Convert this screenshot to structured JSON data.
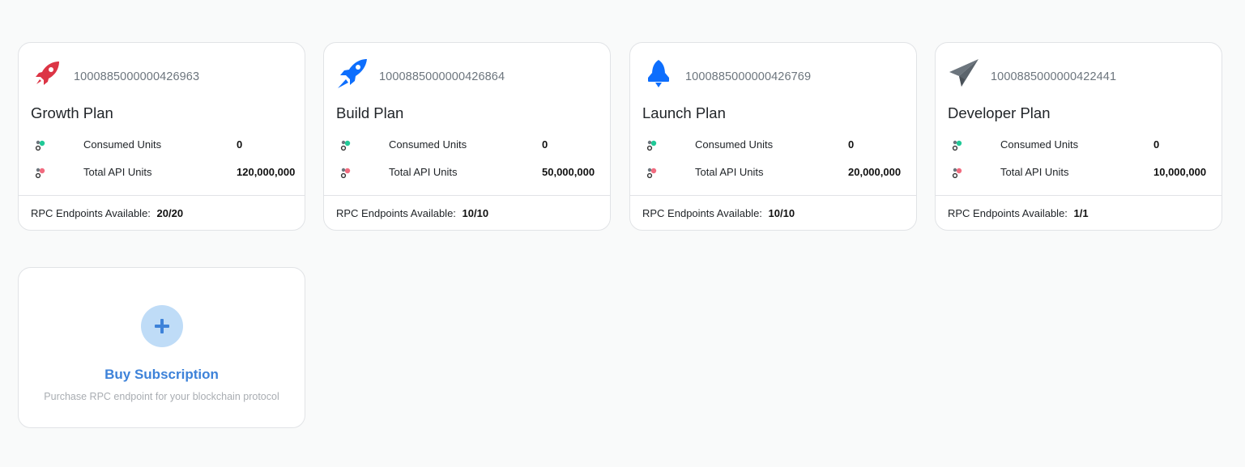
{
  "plans": [
    {
      "id": "1000885000000426963",
      "name": "Growth Plan",
      "icon": "rocket-icon",
      "icon_color": "#dc3545",
      "consumed_label": "Consumed Units",
      "consumed_value": "0",
      "total_label": "Total API Units",
      "total_value": "120,000,000",
      "footer_label": "RPC Endpoints Available:",
      "footer_value": "20/20"
    },
    {
      "id": "1000885000000426864",
      "name": "Build Plan",
      "icon": "rocket-takeoff-icon",
      "icon_color": "#0d6efd",
      "consumed_label": "Consumed Units",
      "consumed_value": "0",
      "total_label": "Total API Units",
      "total_value": "50,000,000",
      "footer_label": "RPC Endpoints Available:",
      "footer_value": "10/10"
    },
    {
      "id": "1000885000000426769",
      "name": "Launch Plan",
      "icon": "rocket-launch-icon",
      "icon_color": "#0d6efd",
      "consumed_label": "Consumed Units",
      "consumed_value": "0",
      "total_label": "Total API Units",
      "total_value": "20,000,000",
      "footer_label": "RPC Endpoints Available:",
      "footer_value": "10/10"
    },
    {
      "id": "1000885000000422441",
      "name": "Developer Plan",
      "icon": "paper-plane-icon",
      "icon_color": "#6c757d",
      "consumed_label": "Consumed Units",
      "consumed_value": "0",
      "total_label": "Total API Units",
      "total_value": "10,000,000",
      "footer_label": "RPC Endpoints Available:",
      "footer_value": "1/1"
    }
  ],
  "stat_icons": {
    "consumed": "consumed-units-icon",
    "consumed_color": "#20c997",
    "total": "total-units-icon",
    "total_color": "#f16b7f"
  },
  "buy": {
    "icon": "plus-icon",
    "title": "Buy Subscription",
    "subtitle": "Purchase RPC endpoint for your blockchain protocol",
    "accent": "#3d82d9",
    "circle_color": "#bfdcf7"
  }
}
